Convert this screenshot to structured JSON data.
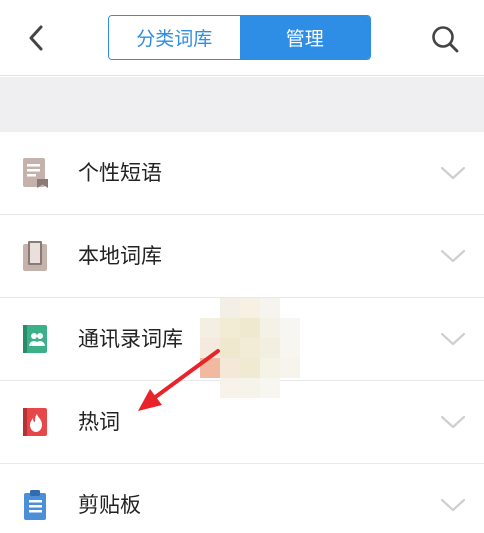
{
  "header": {
    "back_icon": "chevron-left-icon",
    "segments": [
      {
        "label": "分类词库",
        "active": false
      },
      {
        "label": "管理",
        "active": true
      }
    ],
    "search_icon": "search-icon"
  },
  "colors": {
    "accent": "#2e8de5",
    "gap_background": "#efeff1",
    "item_icon_brown": "#c5b2ad",
    "item_icon_green": "#3bb089",
    "item_icon_red": "#e8474a",
    "item_icon_blue": "#4c8fd9",
    "annotation_arrow": "#e8232a"
  },
  "items": [
    {
      "label": "个性短语",
      "icon": "note-book-icon"
    },
    {
      "label": "本地词库",
      "icon": "book-icon"
    },
    {
      "label": "通讯录词库",
      "icon": "contacts-book-icon"
    },
    {
      "label": "热词",
      "icon": "fire-book-icon"
    },
    {
      "label": "剪贴板",
      "icon": "clipboard-icon"
    }
  ]
}
